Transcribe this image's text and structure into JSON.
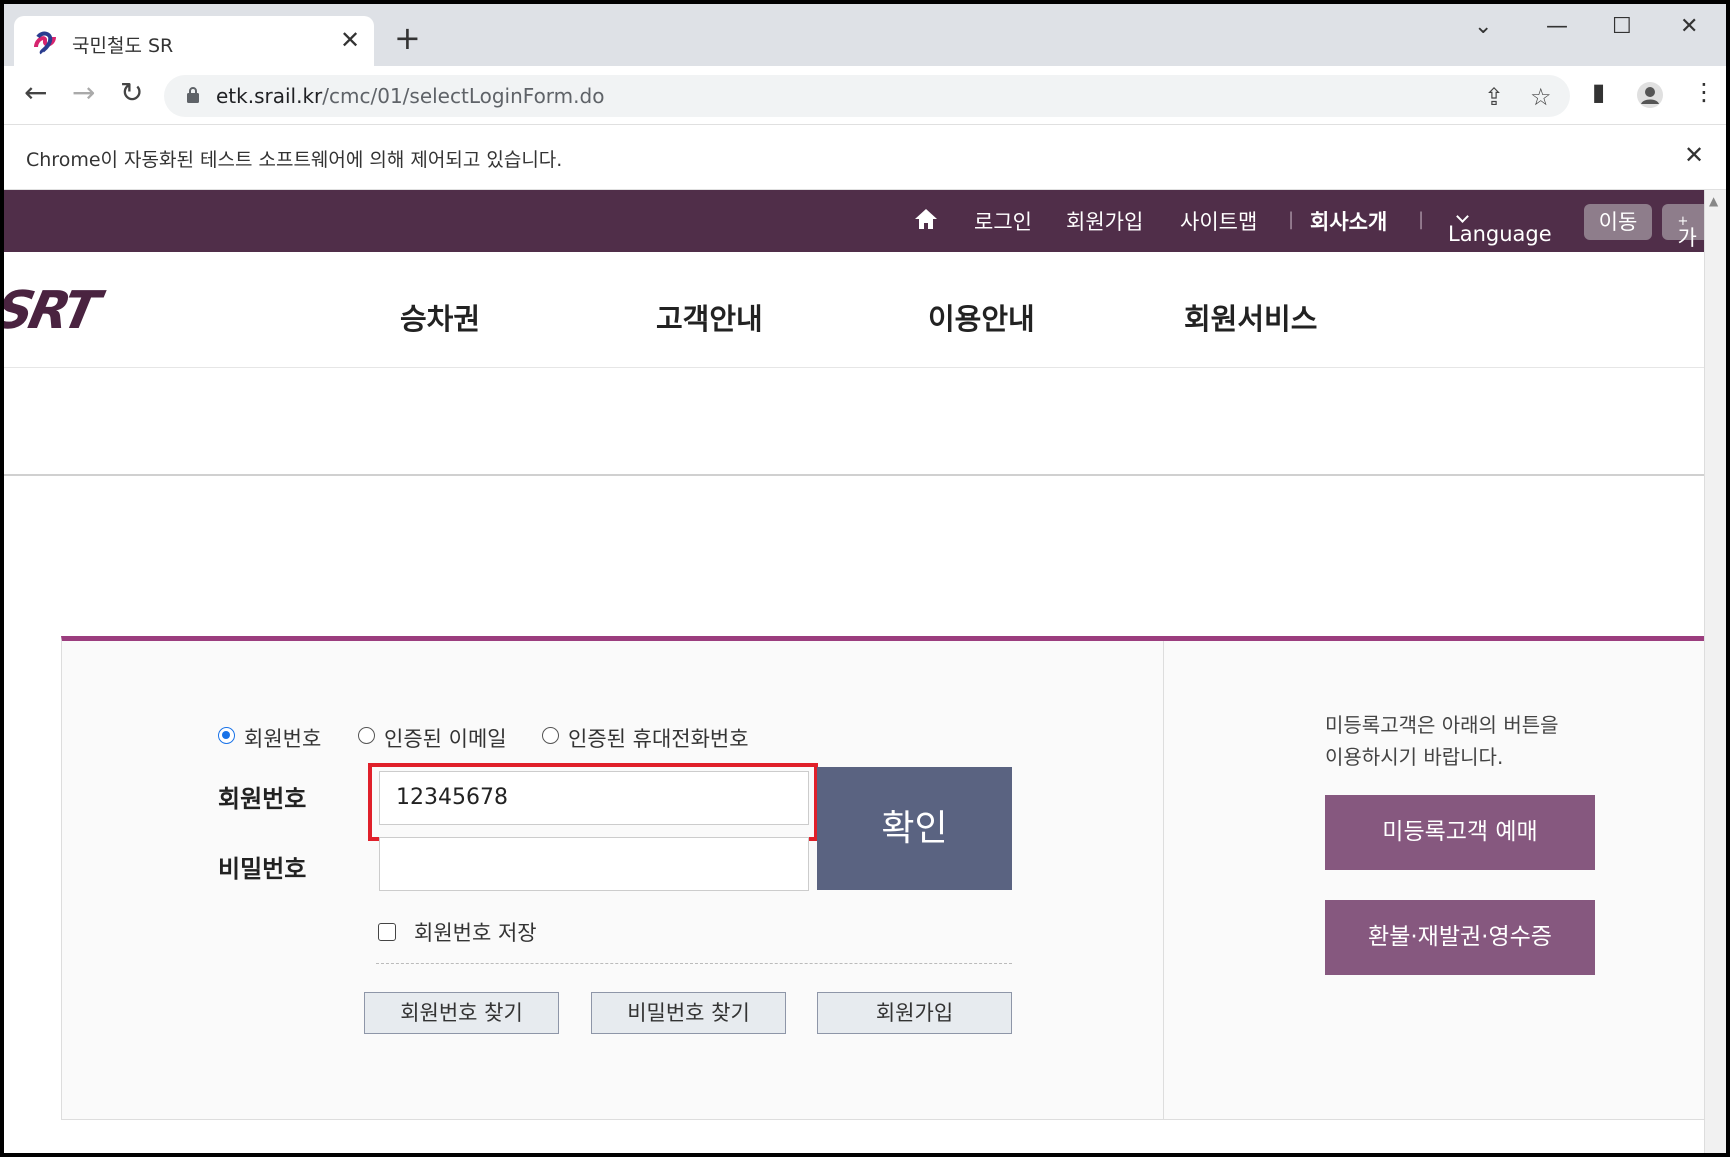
{
  "browser": {
    "tab_title": "국민철도 SR",
    "url_host": "etk.srail.kr",
    "url_path": "/cmc/01/selectLoginForm.do",
    "infobar_text": "Chrome이 자동화된 테스트 소프트웨어에 의해 제어되고 있습니다."
  },
  "topbar": {
    "login": "로그인",
    "join": "회원가입",
    "sitemap": "사이트맵",
    "company": "회사소개",
    "language": "Language",
    "go": "이동",
    "font": "가"
  },
  "gnb": {
    "items": [
      {
        "label": "승차권"
      },
      {
        "label": "고객안내"
      },
      {
        "label": "이용안내"
      },
      {
        "label": "회원서비스"
      }
    ]
  },
  "login": {
    "radios": [
      {
        "label": "회원번호",
        "selected": true
      },
      {
        "label": "인증된 이메일",
        "selected": false
      },
      {
        "label": "인증된 휴대전화번호",
        "selected": false
      }
    ],
    "member_label": "회원번호",
    "member_value": "12345678",
    "password_label": "비밀번호",
    "password_value": "",
    "confirm": "확인",
    "save_label": "회원번호 저장",
    "find_member": "회원번호 찾기",
    "find_password": "비밀번호 찾기",
    "signup": "회원가입"
  },
  "guest": {
    "guide_line1": "미등록고객은 아래의 버튼을",
    "guide_line2": "이용하시기 바랍니다.",
    "reserve": "미등록고객 예매",
    "refund": "환불·재발권·영수증"
  },
  "colors": {
    "topbar": "#502e49",
    "accent": "#9b3d7e",
    "confirm_button": "#5a6381",
    "guest_button": "#86587f",
    "highlight": "#e0202a"
  }
}
